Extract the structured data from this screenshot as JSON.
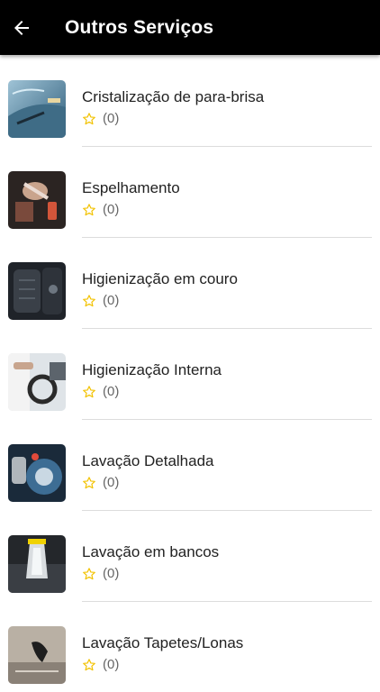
{
  "header": {
    "title": "Outros Serviços",
    "back_icon": "arrow-left-icon"
  },
  "colors": {
    "appbar": "#000000",
    "star": "#f2c200"
  },
  "services": [
    {
      "name": "Cristalização de para-brisa",
      "rating": "(0)",
      "image": "windshield-photo"
    },
    {
      "name": "Espelhamento",
      "rating": "(0)",
      "image": "polishing-photo"
    },
    {
      "name": "Higienização em couro",
      "rating": "(0)",
      "image": "leather-seat-photo"
    },
    {
      "name": "Higienização Interna",
      "rating": "(0)",
      "image": "interior-cleaning-photo"
    },
    {
      "name": "Lavação Detalhada",
      "rating": "(0)",
      "image": "detailed-wash-photo"
    },
    {
      "name": "Lavação em bancos",
      "rating": "(0)",
      "image": "seat-wash-photo"
    },
    {
      "name": "Lavação Tapetes/Lonas",
      "rating": "(0)",
      "image": "mat-wash-photo"
    }
  ]
}
